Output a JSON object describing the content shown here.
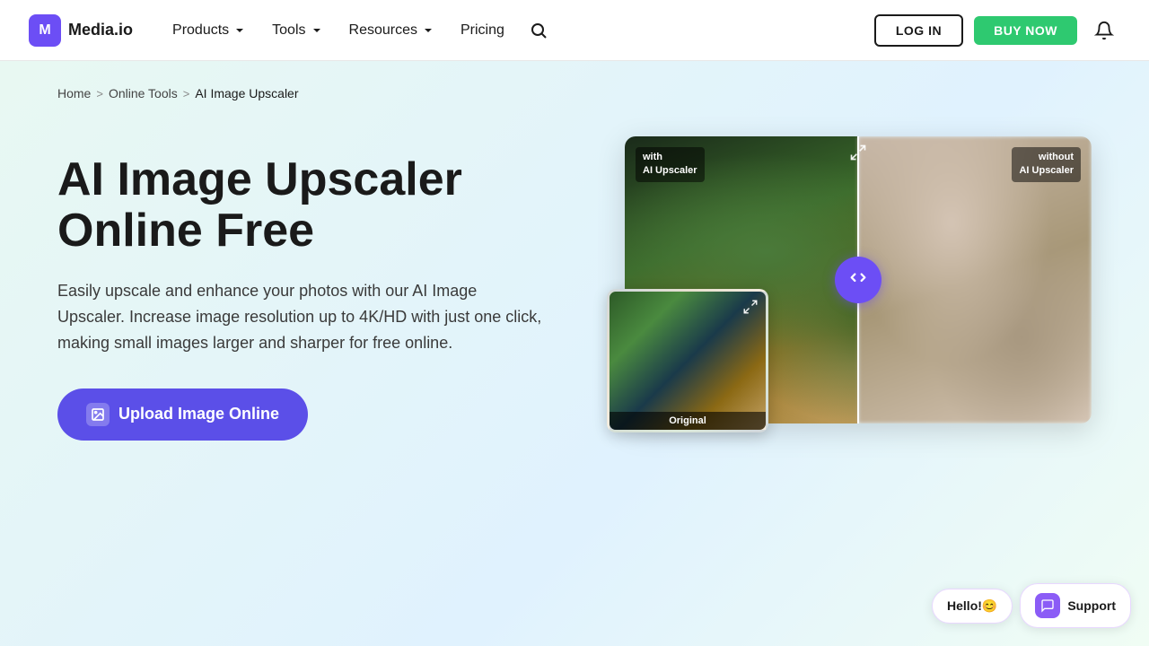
{
  "nav": {
    "logo_text": "Media.io",
    "logo_icon": "M",
    "links": [
      {
        "label": "Products",
        "has_chevron": true
      },
      {
        "label": "Tools",
        "has_chevron": true
      },
      {
        "label": "Resources",
        "has_chevron": true
      },
      {
        "label": "Pricing",
        "has_chevron": false
      }
    ],
    "login_label": "LOG IN",
    "buy_label": "BUY NOW"
  },
  "breadcrumb": {
    "home": "Home",
    "online_tools": "Online Tools",
    "current": "AI Image Upscaler"
  },
  "hero": {
    "title": "AI Image Upscaler Online Free",
    "description": "Easily upscale and enhance your photos with our AI Image Upscaler. Increase image resolution up to 4K/HD with just one click, making small images larger and sharper for free online.",
    "upload_btn": "Upload Image Online"
  },
  "comparison": {
    "label_left_line1": "with",
    "label_left_line2": "AI Upscaler",
    "label_right_line1": "without",
    "label_right_line2": "AI Upscaler",
    "original_label": "Original",
    "handle_icon": "<>"
  },
  "chat": {
    "hello": "Hello!😊",
    "support": "Support"
  }
}
